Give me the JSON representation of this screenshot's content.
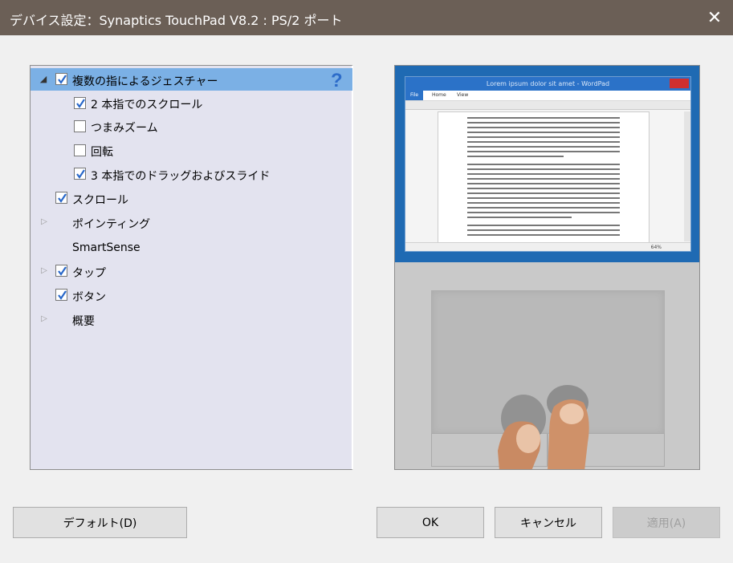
{
  "window": {
    "title": "デバイス設定：Synaptics TouchPad V8.2 : PS/2 ポート",
    "close_glyph": "✕"
  },
  "tree": {
    "help_glyph": "?",
    "items": [
      {
        "label": "複数の指によるジェスチャー",
        "checked": true,
        "expand": "expanded",
        "selected": true
      },
      {
        "label": "2 本指でのスクロール",
        "checked": true
      },
      {
        "label": "つまみズーム",
        "checked": false
      },
      {
        "label": "回転",
        "checked": false
      },
      {
        "label": "3 本指でのドラッグおよびスライド",
        "checked": true
      },
      {
        "label": "スクロール",
        "checked": true
      },
      {
        "label": "ポインティング",
        "expand": "collapsed"
      },
      {
        "label": "SmartSense"
      },
      {
        "label": "タップ",
        "checked": true,
        "expand": "collapsed"
      },
      {
        "label": "ボタン",
        "checked": true
      },
      {
        "label": "概要",
        "expand": "collapsed"
      }
    ]
  },
  "preview": {
    "window_title": "Lorem ipsum dolor sit amet - WordPad",
    "ribbon_file": "File",
    "ribbon_home": "Home",
    "ribbon_view": "View",
    "zoom": "64%"
  },
  "buttons": {
    "default": "デフォルト(D)",
    "ok": "OK",
    "cancel": "キャンセル",
    "apply": "適用(A)"
  },
  "colors": {
    "titlebar": "#6b5f56",
    "selection": "#7bb0e5",
    "tree_bg": "#e3e3ef",
    "check": "#2867c9"
  }
}
